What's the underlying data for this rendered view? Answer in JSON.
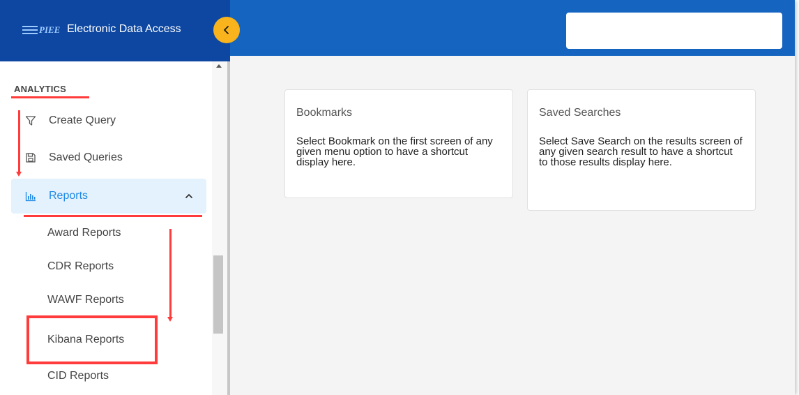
{
  "header": {
    "logo_text": "PIEE",
    "app_title": "Electronic Data Access",
    "search_value": ""
  },
  "sidebar": {
    "section_label": "ANALYTICS",
    "items": [
      {
        "label": "Create Query",
        "icon": "filter-icon"
      },
      {
        "label": "Saved Queries",
        "icon": "save-icon"
      },
      {
        "label": "Reports",
        "icon": "bar-chart-icon",
        "expanded": true
      }
    ],
    "sub_items": [
      {
        "label": "Award Reports"
      },
      {
        "label": "CDR Reports"
      },
      {
        "label": "WAWF Reports"
      },
      {
        "label": "Kibana Reports",
        "highlighted": true
      },
      {
        "label": "CID Reports"
      }
    ]
  },
  "main": {
    "cards": [
      {
        "title": "Bookmarks",
        "body": "Select Bookmark on the first screen of any given menu option to have a shortcut display here."
      },
      {
        "title": "Saved Searches",
        "body": "Select Save Search on the results screen of any given search result to have a shortcut to those results display here."
      }
    ]
  },
  "colors": {
    "header_bg": "#1565c0",
    "brand_bg": "#0d47a1",
    "collapse_button": "#f9b31c",
    "active_item_bg": "#e3f2fd",
    "active_item_text": "#1e88e5",
    "annotation": "#ff3b3b"
  }
}
